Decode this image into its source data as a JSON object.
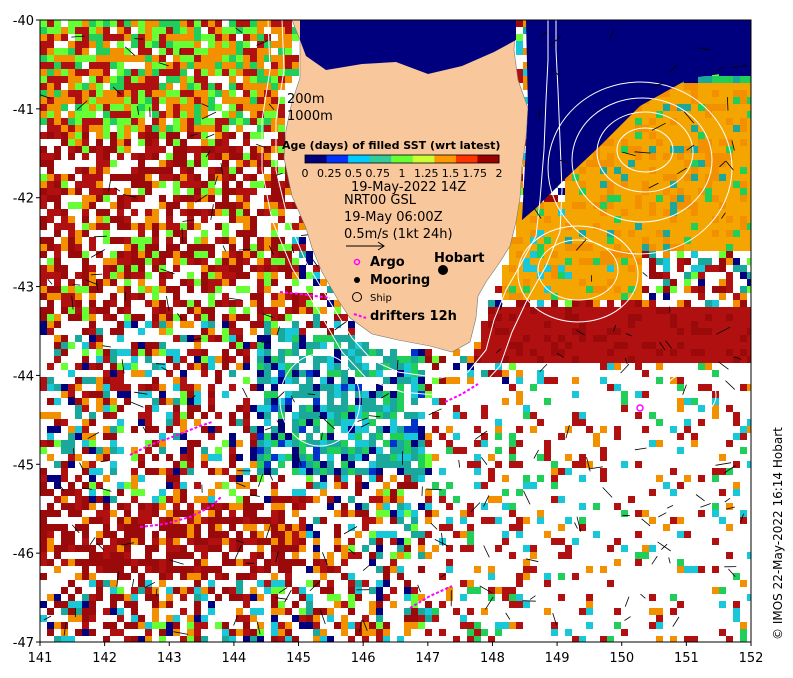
{
  "map": {
    "lon_range": [
      141,
      152
    ],
    "lat_range": [
      -47,
      -40
    ],
    "x_ticks": [
      "141",
      "142",
      "143",
      "144",
      "145",
      "146",
      "147",
      "148",
      "149",
      "150",
      "151",
      "152"
    ],
    "y_ticks": [
      "-40",
      "-41",
      "-42",
      "-43",
      "-44",
      "-45",
      "-46",
      "-47"
    ],
    "colors": {
      "land": "#f9c79c",
      "ocean_none": "#ffffff",
      "deep_blue": "#00007f",
      "age_scale": [
        "#00007f",
        "#0033ff",
        "#00ccff",
        "#33cc99",
        "#66ff33",
        "#ccff33",
        "#ff9900",
        "#ff3300",
        "#990000"
      ]
    }
  },
  "colorbar": {
    "title": "Age (days) of filled SST (wrt latest)",
    "ticks": [
      "0",
      "0.25",
      "0.5",
      "0.75",
      "1",
      "1.25",
      "1.5",
      "1.75",
      "2"
    ]
  },
  "labels": {
    "isobath_200": "200m",
    "isobath_1000": "1000m",
    "date": "19-May-2022 14Z",
    "product": "NRT00 GSL",
    "product_time": "19-May 06:00Z",
    "vector_scale": "0.5m/s (1kt 24h)",
    "city": "Hobart"
  },
  "legend": {
    "argo": "Argo",
    "mooring": "Mooring",
    "ship": "Ship",
    "drifters": "drifters 12h"
  },
  "credit": "© IMOS 22-May-2022 16:14 Hobart"
}
